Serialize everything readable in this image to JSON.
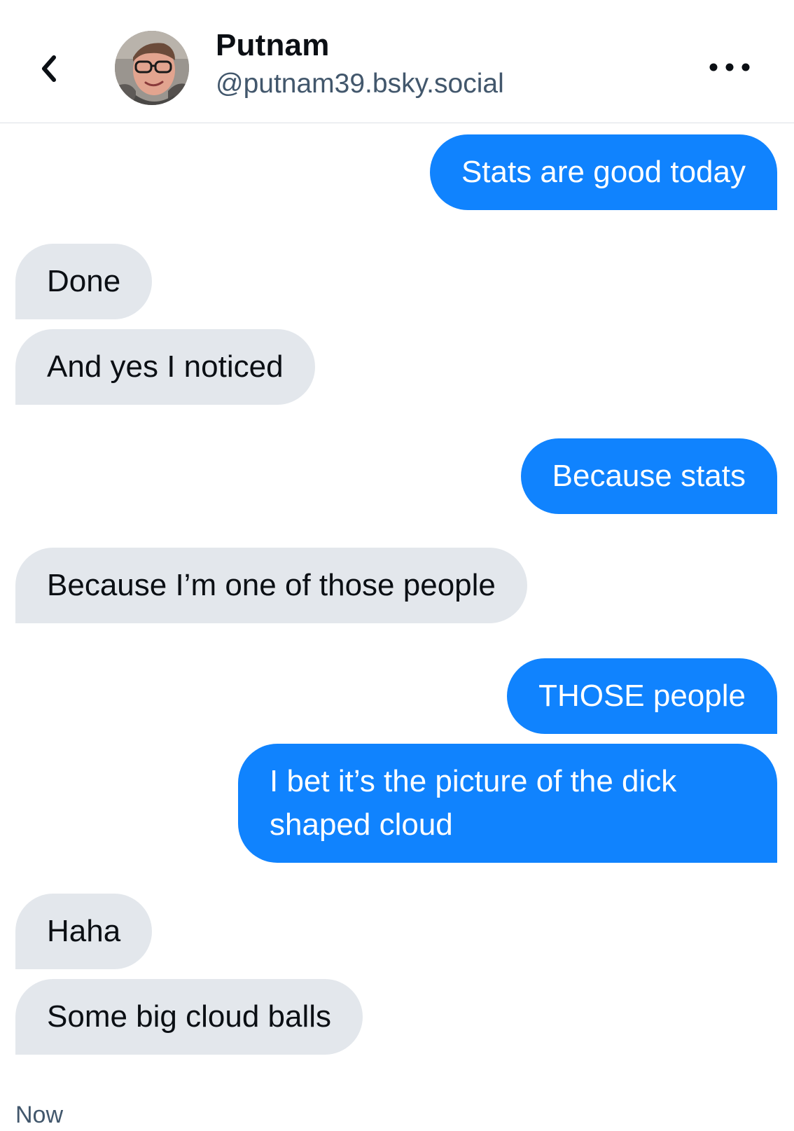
{
  "header": {
    "back_icon": "chevron-left-icon",
    "name": "Putnam",
    "handle": "@putnam39.bsky.social",
    "more_icon": "ellipsis-icon"
  },
  "messages": [
    {
      "from": "me",
      "text": "Stats are good today"
    },
    {
      "from": "them",
      "text": "Done"
    },
    {
      "from": "them",
      "text": "And yes I noticed"
    },
    {
      "from": "me",
      "text": "Because stats"
    },
    {
      "from": "them",
      "text": "Because I’m one of those people"
    },
    {
      "from": "me",
      "text": "THOSE people"
    },
    {
      "from": "me",
      "text": "I bet it’s the picture of the dick shaped cloud"
    },
    {
      "from": "them",
      "text": "Haha"
    },
    {
      "from": "them",
      "text": "Some big cloud balls"
    }
  ],
  "last_timestamp": "Now",
  "colors": {
    "outgoing_bubble": "#1083fe",
    "incoming_bubble": "#e3e7ec",
    "secondary_text": "#42576c"
  }
}
